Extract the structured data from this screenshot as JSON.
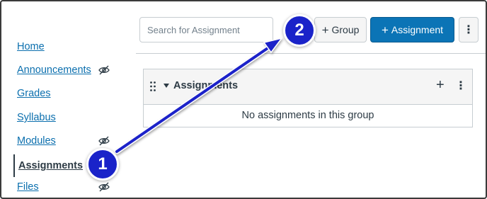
{
  "nav": {
    "items": [
      {
        "label": "Home",
        "hidden": false,
        "active": false
      },
      {
        "label": "Announcements",
        "hidden": true,
        "active": false
      },
      {
        "label": "Grades",
        "hidden": false,
        "active": false
      },
      {
        "label": "Syllabus",
        "hidden": false,
        "active": false
      },
      {
        "label": "Modules",
        "hidden": true,
        "active": false
      },
      {
        "label": "Assignments",
        "hidden": false,
        "active": true
      },
      {
        "label": "Files",
        "hidden": true,
        "active": false
      }
    ],
    "hidden_icon": "eye-off-icon"
  },
  "toolbar": {
    "search_placeholder": "Search for Assignment",
    "group_label": "Group",
    "assignment_label": "Assignment",
    "kebab_label": "⋮"
  },
  "group": {
    "title": "Assignments",
    "empty_message": "No assignments in this group",
    "add_label": "+",
    "kebab_label": "⋮"
  },
  "callouts": {
    "one": "1",
    "two": "2"
  },
  "colors": {
    "link": "#0b6fae",
    "primary_button": "#0b74b6",
    "callout": "#1a23c9",
    "text": "#2d3b45"
  }
}
